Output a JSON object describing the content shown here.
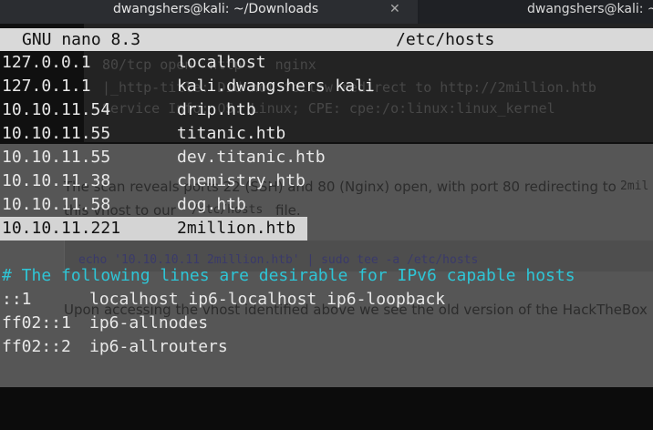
{
  "window": {
    "tabs": [
      {
        "title": "dwangshers@kali: ~/Downloads",
        "active": true,
        "close_glyph": "✕"
      },
      {
        "title": "dwangshers@kali: ~/",
        "active": false
      }
    ]
  },
  "background_page": {
    "scan_lines": [
      "80/tcp open  http    nginx",
      "|_http-title: Did not follow redirect to http://2million.htb",
      "Service Info: OS: Linux; CPE: cpe:/o:linux:linux_kernel"
    ],
    "paragraph1_line1": "The scan reveals ports 22 (SSH) and 80 (Nginx) open, with port 80 redirecting to",
    "paragraph1_code": "2mil",
    "paragraph1_line2": "this vhost to our",
    "paragraph1_code2": "/etc/hosts",
    "paragraph1_tail": "file.",
    "code_block": "echo '10.10.10.11 2million.htb' | sudo tee -a /etc/hosts",
    "paragraph2": "Upon accessing the vhost identified above we see the old version of the HackTheBox"
  },
  "nano": {
    "version_label": "GNU nano 8.3",
    "filename": "/etc/hosts",
    "entries": [
      {
        "ip": "127.0.0.1",
        "host": "localhost"
      },
      {
        "ip": "127.0.1.1",
        "host": "kali.dwangshers kali"
      },
      {
        "ip": "10.10.11.54",
        "host": "drip.htb"
      },
      {
        "ip": "10.10.11.55",
        "host": "titanic.htb"
      },
      {
        "ip": "10.10.11.55",
        "host": "dev.titanic.htb"
      },
      {
        "ip": "10.10.11.38",
        "host": "chemistry.htb"
      },
      {
        "ip": "10.10.11.58",
        "host": "dog.htb"
      },
      {
        "ip": "10.10.11.221",
        "host": "2million.htb"
      }
    ],
    "comment": "# The following lines are desirable for IPv6 capable hosts",
    "ipv6_entries": [
      {
        "ip": "::1",
        "host": "localhost ip6-localhost ip6-loopback"
      },
      {
        "ip": "ff02::1",
        "host": "ip6-allnodes"
      },
      {
        "ip": "ff02::2",
        "host": "ip6-allrouters"
      }
    ]
  }
}
